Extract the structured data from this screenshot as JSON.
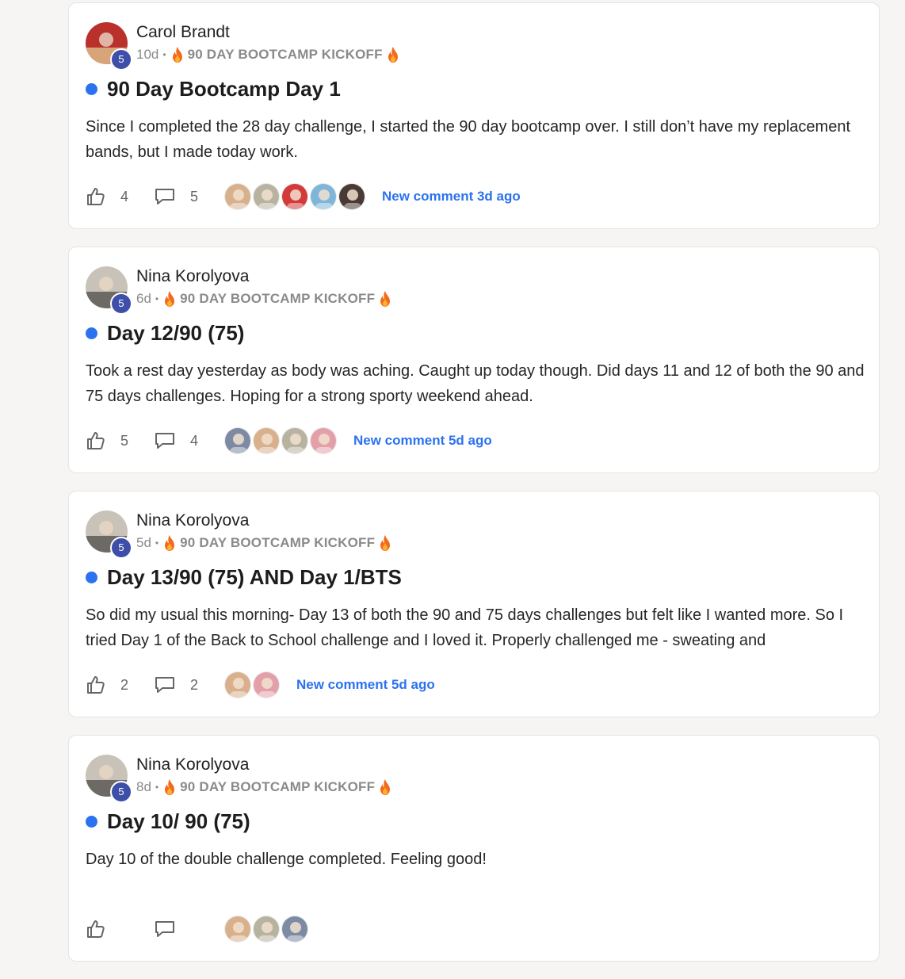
{
  "posts": [
    {
      "author": "Carol Brandt",
      "level": "5",
      "time": "10d",
      "separator": "•",
      "category": "90 DAY BOOTCAMP KICKOFF",
      "title": "90 Day Bootcamp Day 1",
      "body": "Since I completed the 28 day challenge, I started the 90 day bootcamp over. I still don’t have my replacement bands, but I made today work.",
      "likes": "4",
      "comments": "5",
      "participant_count": 5,
      "new_comment": "New comment 3d ago",
      "avatar_colors": [
        "#b9312a",
        "#d8a57a"
      ],
      "participant_colors": [
        "#d9b08c",
        "#b8b2a0",
        "#d33b3b",
        "#7fb5d9",
        "#4a3a35"
      ]
    },
    {
      "author": "Nina Korolyova",
      "level": "5",
      "time": "6d",
      "separator": "•",
      "category": "90 DAY BOOTCAMP KICKOFF",
      "title": "Day 12/90 (75)",
      "body": "Took a rest day yesterday as body was aching. Caught up today though. Did days 11 and 12 of both the 90 and 75 days challenges. Hoping for a strong sporty weekend ahead.",
      "likes": "5",
      "comments": "4",
      "participant_count": 4,
      "new_comment": "New comment 5d ago",
      "avatar_colors": [
        "#c9c2b8",
        "#6d6a66"
      ],
      "participant_colors": [
        "#7d8aa3",
        "#d9b08c",
        "#b8b2a0",
        "#e3a0a8"
      ]
    },
    {
      "author": "Nina Korolyova",
      "level": "5",
      "time": "5d",
      "separator": "•",
      "category": "90 DAY BOOTCAMP KICKOFF",
      "title": "Day 13/90 (75) AND Day 1/BTS",
      "body": "So did my usual this morning- Day 13 of both the 90 and 75 days challenges but felt like I wanted more. So I tried Day 1 of the Back to School challenge and I loved it. Properly challenged me - sweating and",
      "likes": "2",
      "comments": "2",
      "participant_count": 2,
      "new_comment": "New comment 5d ago",
      "avatar_colors": [
        "#c9c2b8",
        "#6d6a66"
      ],
      "participant_colors": [
        "#d9b08c",
        "#e3a0a8"
      ]
    },
    {
      "author": "Nina Korolyova",
      "level": "5",
      "time": "8d",
      "separator": "•",
      "category": "90 DAY BOOTCAMP KICKOFF",
      "title": "Day 10/ 90 (75)",
      "body": "Day 10 of the double challenge completed. Feeling good!",
      "likes": "",
      "comments": "",
      "participant_count": 3,
      "new_comment": "",
      "avatar_colors": [
        "#c9c2b8",
        "#6d6a66"
      ],
      "participant_colors": [
        "#d9b08c",
        "#b8b2a0",
        "#7d8aa3"
      ]
    }
  ]
}
